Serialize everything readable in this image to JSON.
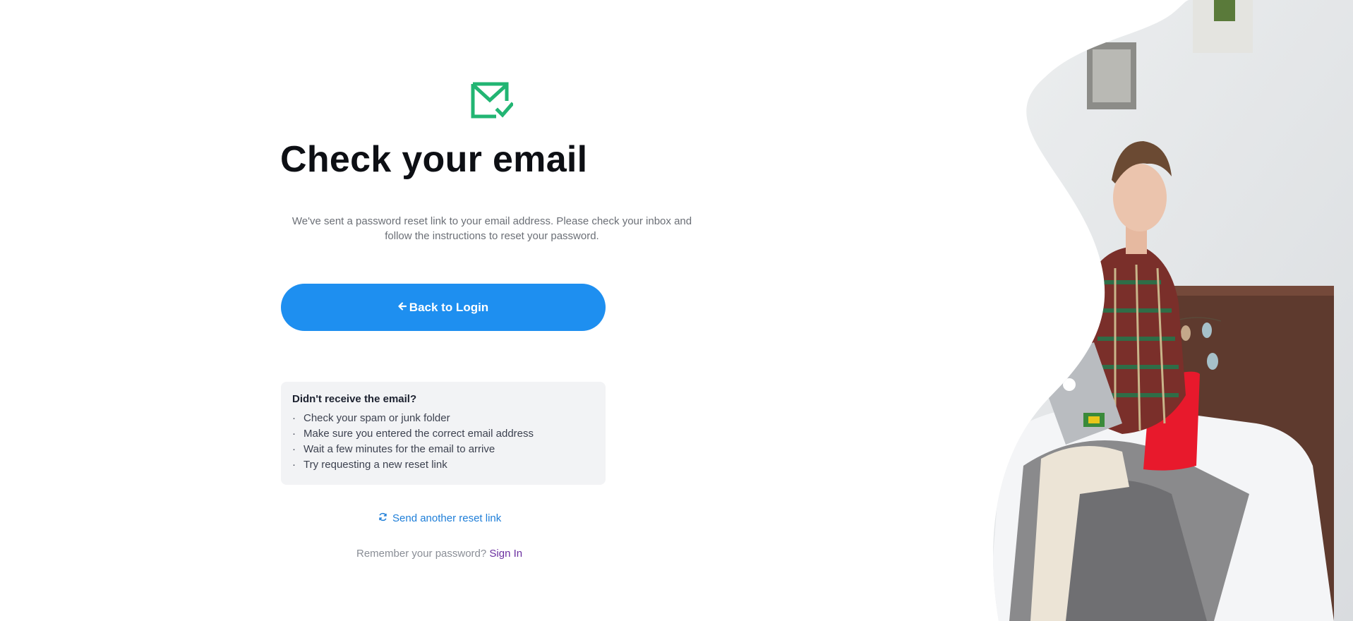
{
  "main": {
    "title": "Check your email",
    "message": "We've sent a password reset link to your email address. Please check your inbox and follow the instructions to reset your password.",
    "back_button_label": "Back to Login",
    "back_button_icon": "arrow-left-icon"
  },
  "help": {
    "title": "Didn't receive the email?",
    "bullet": "·",
    "items": [
      "Check your spam or junk folder",
      "Make sure you entered the correct email address",
      "Wait a few minutes for the email to arrive",
      "Try requesting a new reset link"
    ]
  },
  "resend": {
    "label": "Send another reset link",
    "icon": "refresh-icon"
  },
  "footer": {
    "prompt": "Remember your password?",
    "link": "Sign In"
  },
  "colors": {
    "primary": "#1e8ff0",
    "success_icon": "#22b573",
    "link": "#1e7ed8",
    "signin": "#6b2fa0",
    "help_bg": "#f2f3f5"
  }
}
